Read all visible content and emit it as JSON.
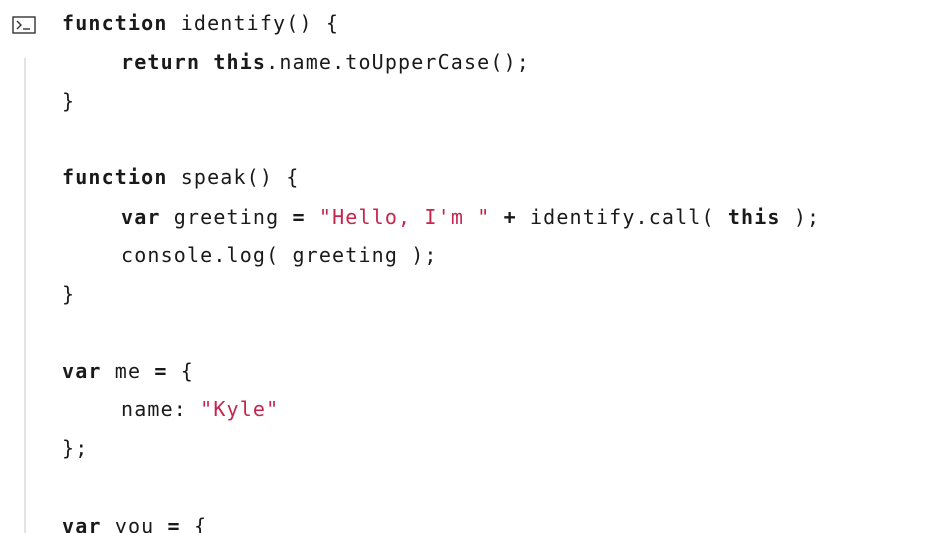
{
  "icons": {
    "copy_to_terminal": "terminal-icon"
  },
  "colors": {
    "string": "#c7254e",
    "gutter": "#e3e3e3",
    "text": "#1a1a1a"
  },
  "code": {
    "l1": {
      "kw": "function",
      "rest": " identify() {"
    },
    "l2": {
      "kw1": "return",
      "sp": " ",
      "kw2": "this",
      "rest": ".name.toUpperCase();"
    },
    "l3": {
      "text": "}"
    },
    "l5": {
      "kw": "function",
      "rest": " speak() {"
    },
    "l6": {
      "kw1": "var",
      "mid1": " greeting ",
      "op1": "=",
      "sp1": " ",
      "str": "\"Hello, I'm \"",
      "sp2": " ",
      "op2": "+",
      "mid2": " identify.call( ",
      "kw2": "this",
      "rest": " );"
    },
    "l7": {
      "text": "console.log( greeting );"
    },
    "l8": {
      "text": "}"
    },
    "l10": {
      "kw": "var",
      "mid": " me ",
      "op": "=",
      "rest": " {"
    },
    "l11": {
      "prefix": "name: ",
      "str": "\"Kyle\""
    },
    "l12": {
      "text": "};"
    },
    "l14": {
      "kw": "var",
      "mid": " you ",
      "op": "=",
      "rest": " {"
    }
  }
}
